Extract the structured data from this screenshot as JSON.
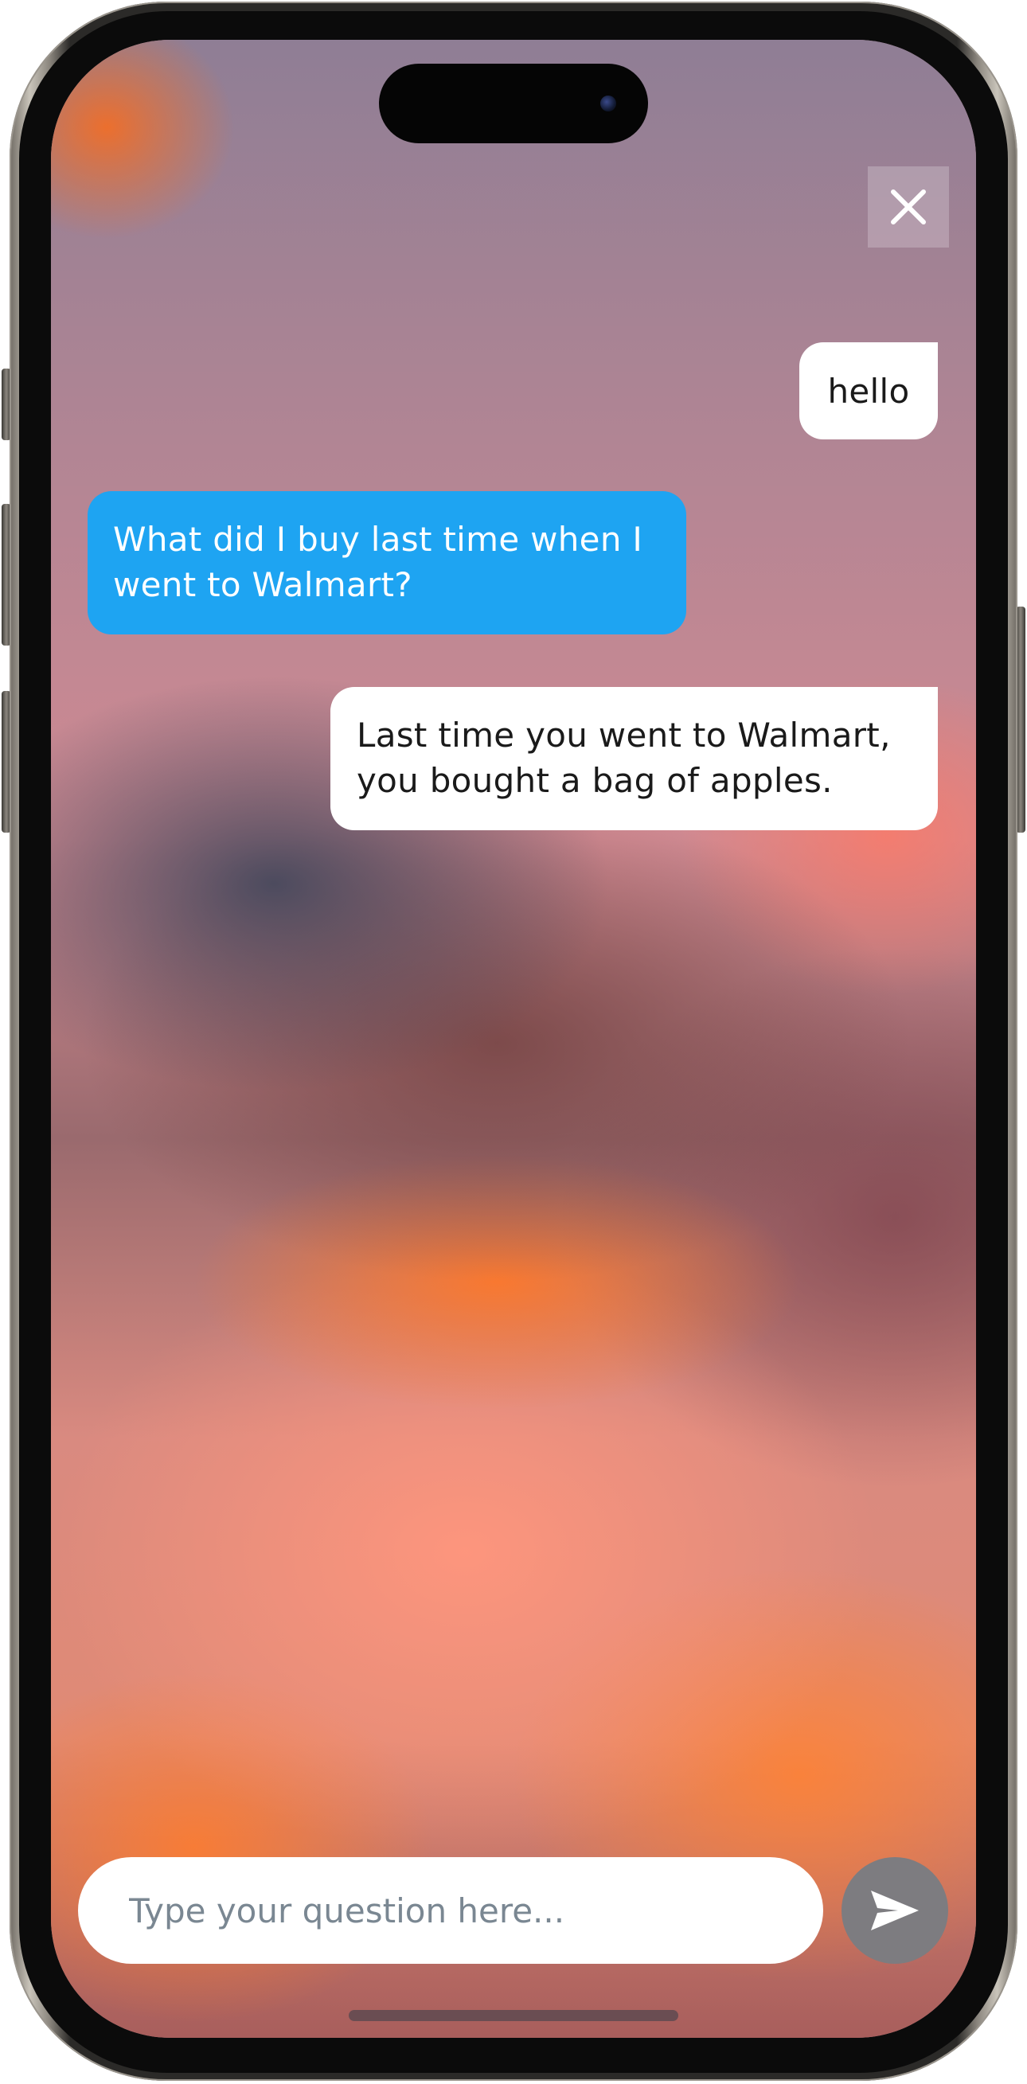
{
  "colors": {
    "user_bubble": "#ffffff",
    "question_bubble": "#1ea4f2",
    "answer_bubble": "#ffffff",
    "send_button": "#7d7c80",
    "close_button_bg": "rgba(255,255,255,0.22)"
  },
  "header": {
    "close_icon": "close-icon"
  },
  "chat": {
    "messages": [
      {
        "role": "user",
        "text": "hello"
      },
      {
        "role": "question",
        "text": "What did I buy last time when I went to Walmart?"
      },
      {
        "role": "answer",
        "text": "Last time you went to Walmart, you bought a bag of apples."
      }
    ]
  },
  "composer": {
    "placeholder": "Type your question here...",
    "value": "",
    "send_icon": "send-icon"
  }
}
